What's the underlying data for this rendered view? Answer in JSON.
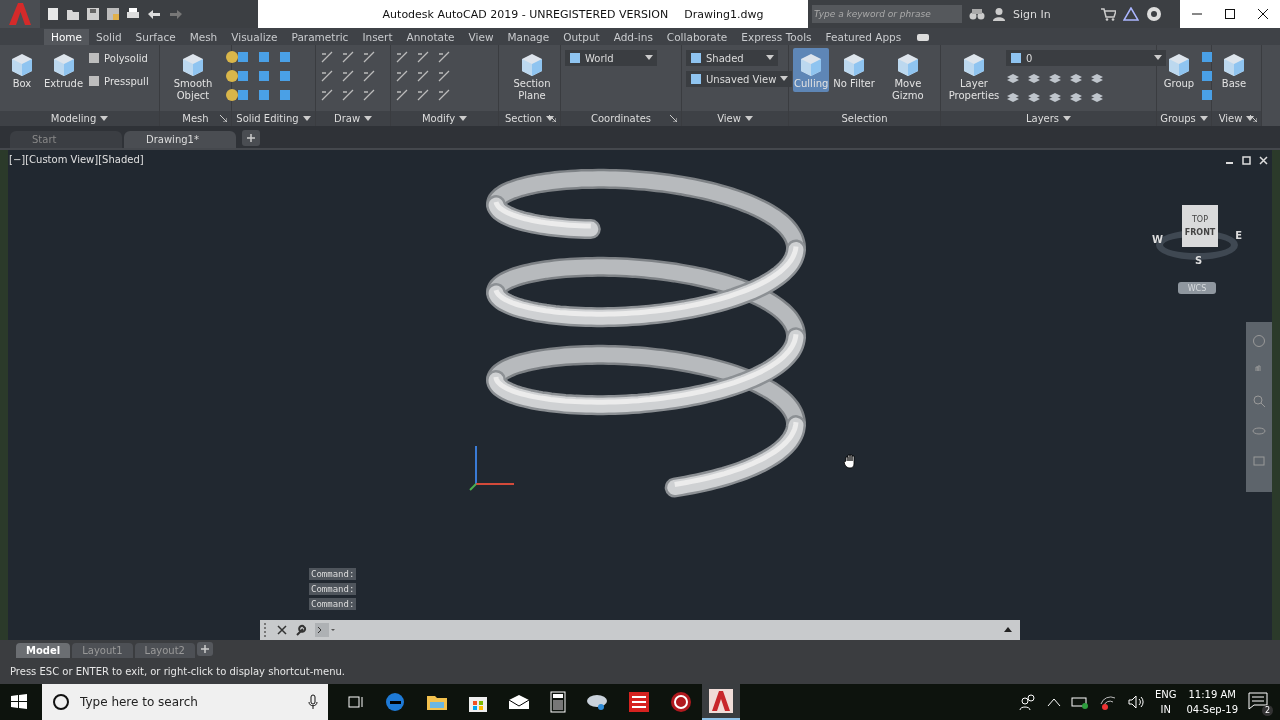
{
  "window": {
    "title": "Autodesk AutoCAD 2019 - UNREGISTERED VERSION",
    "document": "Drawing1.dwg"
  },
  "search": {
    "placeholder": "Type a keyword or phrase"
  },
  "account": {
    "label": "Sign In"
  },
  "ribbon_tabs": [
    {
      "label": "Home",
      "selected": true
    },
    {
      "label": "Solid",
      "selected": false
    },
    {
      "label": "Surface",
      "selected": false
    },
    {
      "label": "Mesh",
      "selected": false
    },
    {
      "label": "Visualize",
      "selected": false
    },
    {
      "label": "Parametric",
      "selected": false
    },
    {
      "label": "Insert",
      "selected": false
    },
    {
      "label": "Annotate",
      "selected": false
    },
    {
      "label": "View",
      "selected": false
    },
    {
      "label": "Manage",
      "selected": false
    },
    {
      "label": "Output",
      "selected": false
    },
    {
      "label": "Add-ins",
      "selected": false
    },
    {
      "label": "Collaborate",
      "selected": false
    },
    {
      "label": "Express Tools",
      "selected": false
    },
    {
      "label": "Featured Apps",
      "selected": false
    }
  ],
  "panels": [
    {
      "title": "Modeling",
      "menu": true,
      "launcher": false,
      "tools": [
        {
          "kind": "large",
          "label": "Box",
          "on": false
        },
        {
          "kind": "large",
          "label": "Extrude",
          "on": false
        },
        {
          "kind": "small",
          "label": "Polysolid"
        },
        {
          "kind": "small",
          "label": "Presspull"
        }
      ]
    },
    {
      "title": "Mesh",
      "menu": false,
      "launcher": true,
      "tools": [
        {
          "kind": "large",
          "label": "Smooth Object",
          "on": false
        }
      ]
    },
    {
      "title": "Solid Editing",
      "menu": true,
      "launcher": false
    },
    {
      "title": "Draw",
      "menu": true,
      "launcher": false
    },
    {
      "title": "Modify",
      "menu": true,
      "launcher": false
    },
    {
      "title": "Section",
      "menu": true,
      "launcher": true,
      "tools": [
        {
          "kind": "large",
          "label": "Section Plane",
          "on": false
        }
      ]
    },
    {
      "title": "Coordinates",
      "menu": false,
      "launcher": true,
      "tools": [
        {
          "kind": "combo",
          "label": "World"
        }
      ]
    },
    {
      "title": "View",
      "menu": true,
      "launcher": false,
      "tools": [
        {
          "kind": "combo",
          "label": "Shaded"
        },
        {
          "kind": "combo",
          "label": "Unsaved View"
        }
      ]
    },
    {
      "title": "Selection",
      "menu": false,
      "launcher": false,
      "tools": [
        {
          "kind": "large",
          "label": "Culling",
          "on": true
        },
        {
          "kind": "large",
          "label": "No Filter",
          "on": false
        },
        {
          "kind": "large",
          "label": "Move Gizmo",
          "on": false
        }
      ]
    },
    {
      "title": "Layers",
      "menu": true,
      "launcher": false,
      "tools": [
        {
          "kind": "large",
          "label": "Layer Properties",
          "on": false
        },
        {
          "kind": "combo",
          "label": "0"
        }
      ]
    },
    {
      "title": "Groups",
      "menu": true,
      "launcher": false,
      "tools": [
        {
          "kind": "large",
          "label": "Group",
          "on": false
        }
      ]
    },
    {
      "title": "View",
      "menu": true,
      "launcher": true,
      "tools": [
        {
          "kind": "large",
          "label": "Base",
          "on": false
        }
      ]
    }
  ],
  "file_tabs": [
    {
      "label": "Start",
      "selected": false
    },
    {
      "label": "Drawing1*",
      "selected": true
    }
  ],
  "viewport": {
    "label": "[−][Custom View][Shaded]"
  },
  "viewcube": {
    "top": "TOP",
    "front": "FRONT",
    "west": "W",
    "east": "E",
    "south": "S",
    "ucs": "WCS"
  },
  "command_history": [
    "Command:",
    "Command:",
    "Command:"
  ],
  "layout_tabs": [
    {
      "label": "Model",
      "selected": true
    },
    {
      "label": "Layout1",
      "selected": false
    },
    {
      "label": "Layout2",
      "selected": false
    }
  ],
  "status_message": "Press ESC or ENTER to exit, or right-click to display shortcut-menu.",
  "taskbar": {
    "search_placeholder": "Type here to search",
    "language": "ENG",
    "region": "IN",
    "time": "11:19 AM",
    "date": "04-Sep-19",
    "notifications": "2"
  }
}
